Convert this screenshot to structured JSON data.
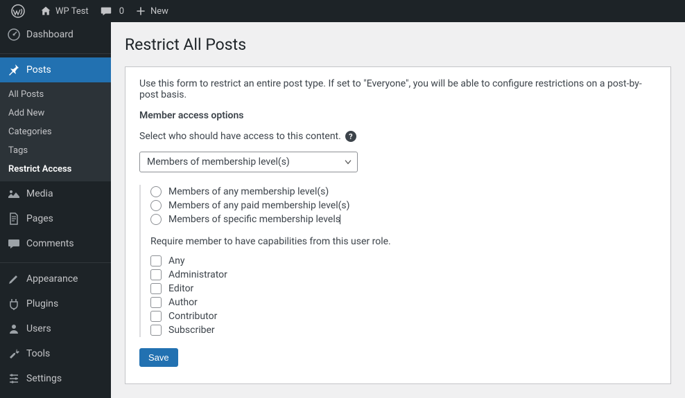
{
  "adminbar": {
    "site_name": "WP Test",
    "comments_count": "0",
    "new_label": "New"
  },
  "sidebar": {
    "dashboard": "Dashboard",
    "posts": "Posts",
    "posts_sub": {
      "all": "All Posts",
      "add": "Add New",
      "categories": "Categories",
      "tags": "Tags",
      "restrict": "Restrict Access"
    },
    "media": "Media",
    "pages": "Pages",
    "comments": "Comments",
    "appearance": "Appearance",
    "plugins": "Plugins",
    "users": "Users",
    "tools": "Tools",
    "settings": "Settings"
  },
  "page": {
    "title": "Restrict All Posts",
    "intro": "Use this form to restrict an entire post type. If set to \"Everyone\", you will be able to configure restrictions on a post-by-post basis.",
    "section_label": "Member access options",
    "select_help": "Select who should have access to this content.",
    "dropdown_value": "Members of membership level(s)",
    "radios": {
      "r1": "Members of any membership level(s)",
      "r2": "Members of any paid membership level(s)",
      "r3": "Members of specific membership levels"
    },
    "role_label": "Require member to have capabilities from this user role.",
    "roles": {
      "any": "Any",
      "admin": "Administrator",
      "editor": "Editor",
      "author": "Author",
      "contributor": "Contributor",
      "subscriber": "Subscriber"
    },
    "save": "Save"
  }
}
